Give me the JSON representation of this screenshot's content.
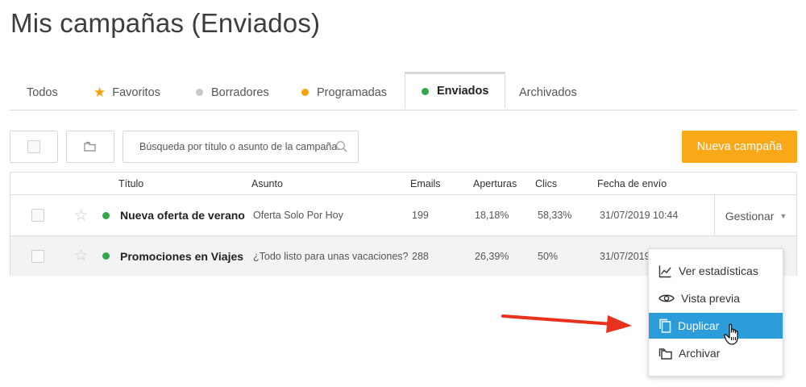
{
  "page": {
    "title": "Mis campañas (Enviados)"
  },
  "tabs": [
    {
      "label": "Todos",
      "icon": "",
      "color": ""
    },
    {
      "label": "Favoritos",
      "icon": "star-icon",
      "color": "#f5a30a"
    },
    {
      "label": "Borradores",
      "icon": "dot-icon",
      "color": "#c8c8c8"
    },
    {
      "label": "Programadas",
      "icon": "dot-icon",
      "color": "#f5a30a"
    },
    {
      "label": "Enviados",
      "icon": "dot-icon",
      "color": "#33a84b",
      "active": true
    },
    {
      "label": "Archivados",
      "icon": "",
      "color": ""
    }
  ],
  "toolbar": {
    "search_placeholder": "Búsqueda por título o asunto de la campaña.",
    "new_campaign_label": "Nueva campaña",
    "accent": "#f9a818"
  },
  "table": {
    "headers": {
      "title": "Título",
      "subject": "Asunto",
      "emails": "Emails",
      "opens": "Aperturas",
      "clicks": "Clics",
      "sent_date": "Fecha de envío"
    },
    "rows": [
      {
        "title": "Nueva oferta de verano",
        "subject": "Oferta Solo Por Hoy",
        "emails": "199",
        "opens": "18,18%",
        "clicks": "58,33%",
        "sent_date": "31/07/2019 10:44",
        "status_color": "#33a84b"
      },
      {
        "title": "Promociones en Viajes",
        "subject": "¿Todo listo para unas vacaciones?",
        "emails": "288",
        "opens": "26,39%",
        "clicks": "50%",
        "sent_date": "31/07/2019",
        "status_color": "#33a84b"
      }
    ],
    "manage_label": "Gestionar"
  },
  "menu": {
    "items": [
      {
        "label": "Ver estadísticas",
        "icon": "chart-icon"
      },
      {
        "label": "Vista previa",
        "icon": "eye-icon"
      },
      {
        "label": "Duplicar",
        "icon": "copy-icon",
        "highlighted": true
      },
      {
        "label": "Archivar",
        "icon": "archive-icon"
      }
    ],
    "highlight_color": "#2d9cdb"
  },
  "annotation": {
    "arrow_color": "#e8321e"
  }
}
